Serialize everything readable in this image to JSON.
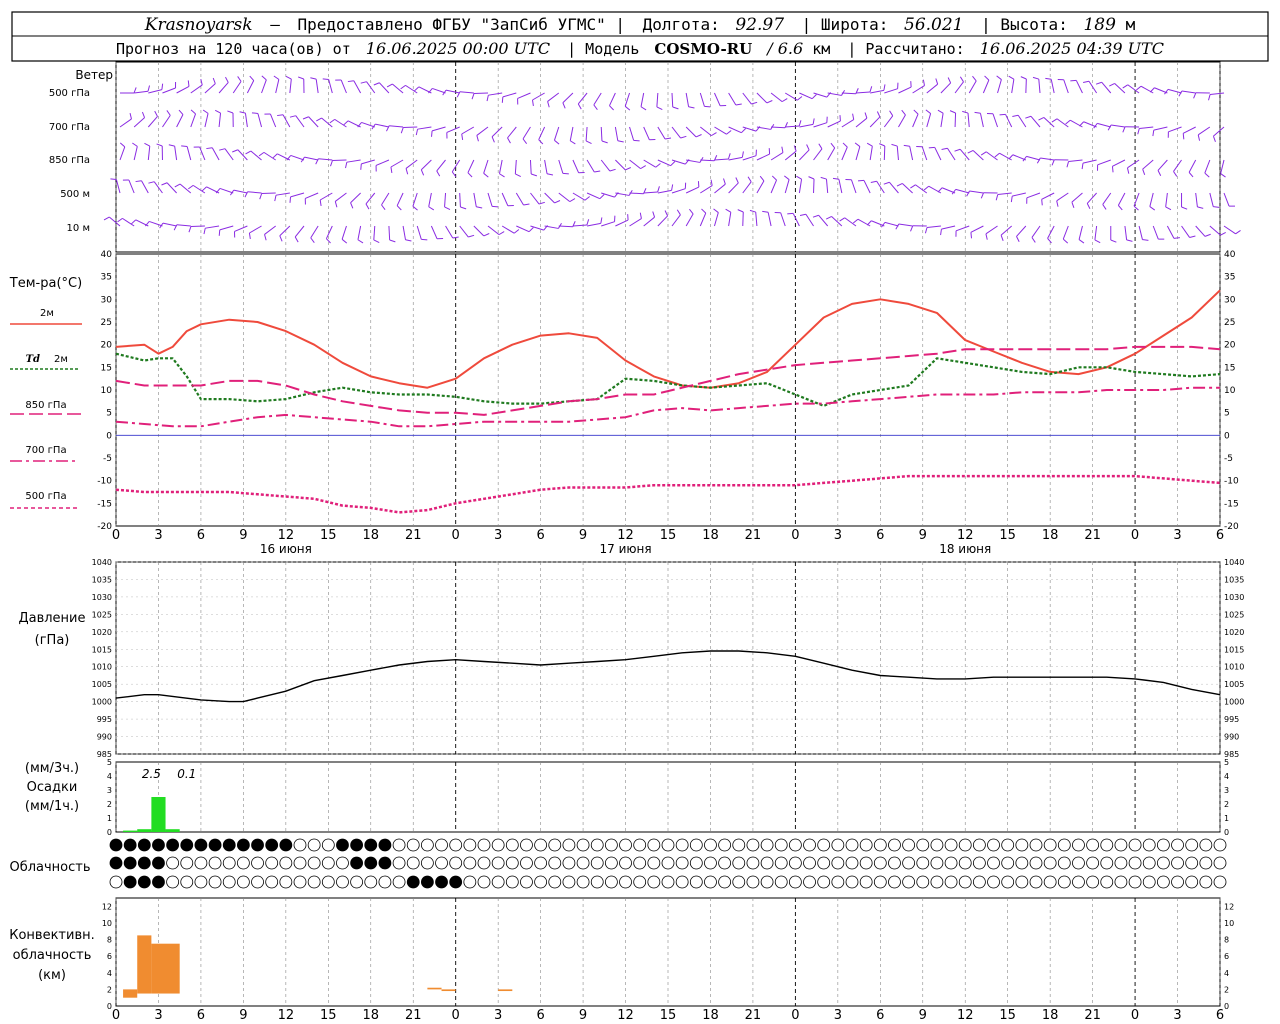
{
  "header": {
    "city": "Krasnoyarsk",
    "dash": "—",
    "provider_label": "Предоставлено ФГБУ \"ЗапСиб УГМС\" |",
    "lon_label": "Долгота:",
    "lon_value": "92.97",
    "lat_label": "| Широта:",
    "lat_value": "56.021",
    "alt_label": "| Высота:",
    "alt_value": "189",
    "alt_unit": "м",
    "forecast_label": "Прогноз на 120 часа(ов) от",
    "forecast_start": "16.06.2025 00:00 UTC",
    "model_label": "| Модель",
    "model_name": "COSMO-RU",
    "model_res": "/ 6.6",
    "model_res_unit": "км",
    "computed_label": "| Рассчитано:",
    "computed_at": "16.06.2025 04:39 UTC"
  },
  "time_axis": {
    "tick_labels": [
      "0",
      "3",
      "6",
      "9",
      "12",
      "15",
      "18",
      "21",
      "0",
      "3",
      "6",
      "9",
      "12",
      "15",
      "18",
      "21",
      "0",
      "3",
      "6",
      "9",
      "12",
      "15",
      "18",
      "21",
      "0",
      "3",
      "6"
    ],
    "day_labels": [
      {
        "text": "16 июня",
        "at_hour": 12
      },
      {
        "text": "17 июня",
        "at_hour": 36
      },
      {
        "text": "18 июня",
        "at_hour": 60
      }
    ]
  },
  "wind_panel": {
    "title": "Ветер",
    "levels": [
      "500 гПа",
      "700 гПа",
      "850 гПа",
      "500 м",
      "10  м"
    ]
  },
  "temp_panel": {
    "title": "Тем-ра(°С)",
    "legend": [
      {
        "label": "2м",
        "prefix": "",
        "color": "#ef4a3c"
      },
      {
        "label": "2м",
        "prefix": "Td",
        "color": "#1f7a1f"
      },
      {
        "label": "850 гПа",
        "prefix": "",
        "color": "#e0207a"
      },
      {
        "label": "700 гПа",
        "prefix": "",
        "color": "#e0207a"
      },
      {
        "label": "500 гПа",
        "prefix": "",
        "color": "#e0207a"
      }
    ],
    "y_ticks": [
      "40",
      "35",
      "30",
      "25",
      "20",
      "15",
      "10",
      "5",
      "0",
      "-5",
      "-10",
      "-15",
      "-20"
    ]
  },
  "pressure_panel": {
    "title": "Давление",
    "unit": "(гПа)",
    "y_ticks": [
      "1040",
      "1035",
      "1030",
      "1025",
      "1020",
      "1015",
      "1010",
      "1005",
      "1000",
      "995",
      "990",
      "985"
    ]
  },
  "precip_panel": {
    "unit_top": "(мм/3ч.)",
    "title": "Осадки",
    "unit_bottom": "(мм/1ч.)",
    "annotations": [
      {
        "text": "2.5",
        "at_hour": 2.5
      },
      {
        "text": "0.1",
        "at_hour": 5
      }
    ],
    "y_ticks": [
      "5",
      "4",
      "3",
      "2",
      "1",
      "0"
    ]
  },
  "cloud_panel": {
    "title": "Облачность",
    "colors": {
      "filled": "#000000",
      "empty": "#ffffff"
    }
  },
  "conv_panel": {
    "title_1": "Конвективн.",
    "title_2": "облачность",
    "unit": "(км)",
    "y_ticks": [
      "12",
      "10",
      "8",
      "6",
      "4",
      "2",
      "0"
    ]
  },
  "colors": {
    "wind": "#8a2be2",
    "t2m": "#ef4a3c",
    "td2m": "#1f7a1f",
    "levels": "#e0207a",
    "pressure": "#000000",
    "precip": "#22dd22",
    "conv": "#f08c30",
    "zero_line": "#3333cc"
  },
  "chart_data": [
    {
      "type": "line",
      "title": "Тем-ра(°С)",
      "ylim": [
        -20,
        40
      ],
      "series": [
        {
          "name": "2м",
          "x": [
            0,
            2,
            3,
            4,
            5,
            6,
            8,
            10,
            12,
            14,
            16,
            18,
            20,
            22,
            24,
            26,
            28,
            30,
            32,
            34,
            36,
            38,
            40,
            42,
            44,
            46,
            48,
            50,
            52,
            54,
            56,
            58,
            60,
            62,
            64,
            66,
            68,
            70,
            72,
            74,
            76,
            78
          ],
          "values": [
            19.5,
            20,
            18,
            19.5,
            23,
            24.5,
            25.5,
            25,
            23,
            20,
            16,
            13,
            11.5,
            10.5,
            12.5,
            17,
            20,
            22,
            22.5,
            21.5,
            16.5,
            13,
            11,
            10.5,
            11.5,
            14,
            20,
            26,
            29,
            30,
            29,
            27,
            21,
            18.5,
            16,
            14,
            13.5,
            15,
            18,
            22,
            26,
            32
          ]
        },
        {
          "name": "Td 2м",
          "x": [
            0,
            2,
            3,
            4,
            5,
            6,
            8,
            10,
            12,
            14,
            16,
            18,
            20,
            22,
            24,
            26,
            28,
            30,
            32,
            34,
            36,
            38,
            40,
            42,
            44,
            46,
            48,
            50,
            52,
            54,
            56,
            58,
            60,
            62,
            64,
            66,
            68,
            70,
            72,
            74,
            76,
            78
          ],
          "values": [
            18,
            16.5,
            17,
            17,
            13,
            8,
            8,
            7.5,
            8,
            9.5,
            10.5,
            9.5,
            9,
            9,
            8.5,
            7.5,
            7,
            7,
            7.5,
            8,
            12.5,
            12,
            11,
            10.5,
            11,
            11.5,
            9,
            6.5,
            9,
            10,
            11,
            17,
            16,
            15,
            14,
            13.5,
            15,
            15,
            14,
            13.5,
            13,
            13.5
          ]
        },
        {
          "name": "850 гПа",
          "x": [
            0,
            2,
            4,
            6,
            8,
            10,
            12,
            14,
            16,
            18,
            20,
            22,
            24,
            26,
            28,
            30,
            32,
            34,
            36,
            38,
            40,
            42,
            44,
            46,
            48,
            50,
            52,
            54,
            56,
            58,
            60,
            62,
            64,
            66,
            68,
            70,
            72,
            74,
            76,
            78
          ],
          "values": [
            12,
            11,
            11,
            11,
            12,
            12,
            11,
            9,
            7.5,
            6.5,
            5.5,
            5,
            5,
            4.5,
            5.5,
            6.5,
            7.5,
            8,
            9,
            9,
            10.5,
            12,
            13.5,
            14.5,
            15.5,
            16,
            16.5,
            17,
            17.5,
            18,
            19,
            19,
            19,
            19,
            19,
            19,
            19.5,
            19.5,
            19.5,
            19
          ]
        },
        {
          "name": "700 гПа",
          "x": [
            0,
            2,
            4,
            6,
            8,
            10,
            12,
            14,
            16,
            18,
            20,
            22,
            24,
            26,
            28,
            30,
            32,
            34,
            36,
            38,
            40,
            42,
            44,
            46,
            48,
            50,
            52,
            54,
            56,
            58,
            60,
            62,
            64,
            66,
            68,
            70,
            72,
            74,
            76,
            78
          ],
          "values": [
            3,
            2.5,
            2,
            2,
            3,
            4,
            4.5,
            4,
            3.5,
            3,
            2,
            2,
            2.5,
            3,
            3,
            3,
            3,
            3.5,
            4,
            5.5,
            6,
            5.5,
            6,
            6.5,
            7,
            7,
            7.5,
            8,
            8.5,
            9,
            9,
            9,
            9.5,
            9.5,
            9.5,
            10,
            10,
            10,
            10.5,
            10.5
          ]
        },
        {
          "name": "500 гПа",
          "x": [
            0,
            2,
            4,
            6,
            8,
            10,
            12,
            14,
            16,
            18,
            20,
            22,
            24,
            26,
            28,
            30,
            32,
            34,
            36,
            38,
            40,
            42,
            44,
            46,
            48,
            50,
            52,
            54,
            56,
            58,
            60,
            62,
            64,
            66,
            68,
            70,
            72,
            74,
            76,
            78
          ],
          "values": [
            -12,
            -12.5,
            -12.5,
            -12.5,
            -12.5,
            -13,
            -13.5,
            -14,
            -15.5,
            -16,
            -17,
            -16.5,
            -15,
            -14,
            -13,
            -12,
            -11.5,
            -11.5,
            -11.5,
            -11,
            -11,
            -11,
            -11,
            -11,
            -11,
            -10.5,
            -10,
            -9.5,
            -9,
            -9,
            -9,
            -9,
            -9,
            -9,
            -9,
            -9,
            -9,
            -9.5,
            -10,
            -10.5
          ]
        }
      ]
    },
    {
      "type": "line",
      "title": "Давление",
      "ylim": [
        985,
        1040
      ],
      "x": [
        0,
        2,
        3,
        4,
        6,
        8,
        9,
        10,
        12,
        14,
        16,
        18,
        20,
        22,
        24,
        26,
        28,
        30,
        32,
        34,
        36,
        38,
        40,
        42,
        44,
        46,
        48,
        50,
        52,
        54,
        56,
        58,
        60,
        62,
        64,
        66,
        68,
        70,
        72,
        74,
        76,
        78
      ],
      "values": [
        1001,
        1002,
        1002,
        1001.5,
        1000.5,
        1000,
        1000,
        1001,
        1003,
        1006,
        1007.5,
        1009,
        1010.5,
        1011.5,
        1012,
        1011.5,
        1011,
        1010.5,
        1011,
        1011.5,
        1012,
        1013,
        1014,
        1014.5,
        1014.5,
        1014,
        1013,
        1011,
        1009,
        1007.5,
        1007,
        1006.5,
        1006.5,
        1007,
        1007,
        1007,
        1007,
        1007,
        1006.5,
        1005.5,
        1003.5,
        1002
      ]
    },
    {
      "type": "bar",
      "title": "Осадки",
      "ylim": [
        0,
        5
      ],
      "x": [
        1,
        2,
        3,
        4
      ],
      "values": [
        0.1,
        0.2,
        2.5,
        0.2
      ]
    },
    {
      "type": "bar",
      "title": "Конвективн. облачность",
      "ylim": [
        0,
        13
      ],
      "bars": [
        {
          "x_start": 0.5,
          "x_end": 1.5,
          "bottom": 1,
          "top": 2
        },
        {
          "x_start": 1.5,
          "x_end": 2.5,
          "bottom": 1.5,
          "top": 8.5
        },
        {
          "x_start": 2.5,
          "x_end": 4.5,
          "bottom": 1.5,
          "top": 7.5
        },
        {
          "x_start": 22,
          "x_end": 23,
          "bottom": 2,
          "top": 2.2
        },
        {
          "x_start": 23,
          "x_end": 24,
          "bottom": 1.8,
          "top": 2
        },
        {
          "x_start": 27,
          "x_end": 28,
          "bottom": 1.8,
          "top": 2
        }
      ]
    }
  ]
}
